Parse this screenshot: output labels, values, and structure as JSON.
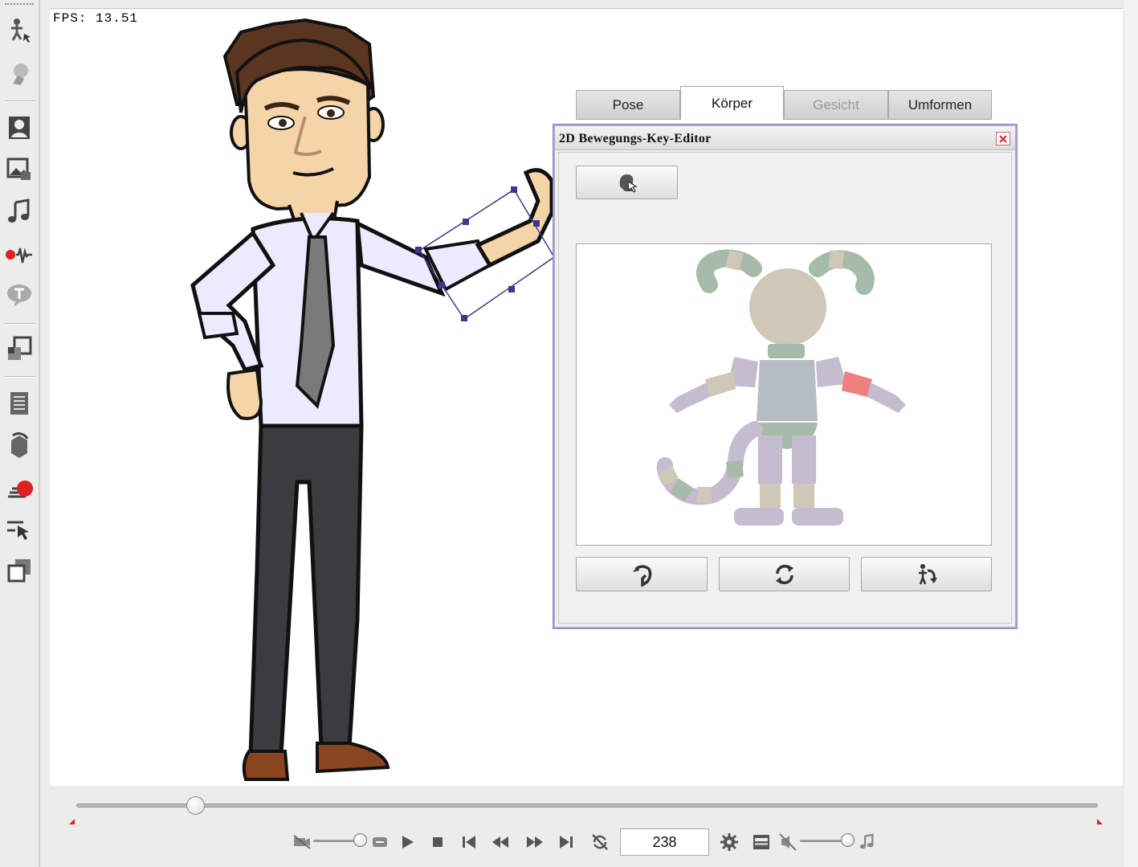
{
  "stage": {
    "fps_label": "FPS: 13.51"
  },
  "toolbar": {
    "buttons": [
      {
        "id": "motion-pilot",
        "icon": "figure-cursor-icon"
      },
      {
        "id": "puppet",
        "icon": "puppet-icon"
      },
      {
        "id": "actor",
        "icon": "actor-icon"
      },
      {
        "id": "scene",
        "icon": "scene-icon"
      },
      {
        "id": "music",
        "icon": "music-note-icon"
      },
      {
        "id": "voice-record",
        "icon": "audio-wave-icon"
      },
      {
        "id": "text-balloon",
        "icon": "text-balloon-icon"
      },
      {
        "id": "prop",
        "icon": "prop-icon"
      },
      {
        "id": "script",
        "icon": "script-icon"
      },
      {
        "id": "replace",
        "icon": "replace-icon"
      },
      {
        "id": "record",
        "icon": "record-icon"
      },
      {
        "id": "select",
        "icon": "select-cursor-icon"
      },
      {
        "id": "layers",
        "icon": "layers-icon"
      }
    ]
  },
  "editor": {
    "title": "2D Bewegungs-Key-Editor",
    "tabs": [
      {
        "label": "Pose",
        "state": "normal"
      },
      {
        "label": "Körper",
        "state": "active"
      },
      {
        "label": "Gesicht",
        "state": "disabled"
      },
      {
        "label": "Umformen",
        "state": "normal"
      }
    ],
    "selected_part_color": "#f08080"
  },
  "timeline": {
    "frame": "238",
    "progress": 0.116
  },
  "colors": {
    "accent_red": "#e02020",
    "selection_frame": "#3a3a8c"
  }
}
